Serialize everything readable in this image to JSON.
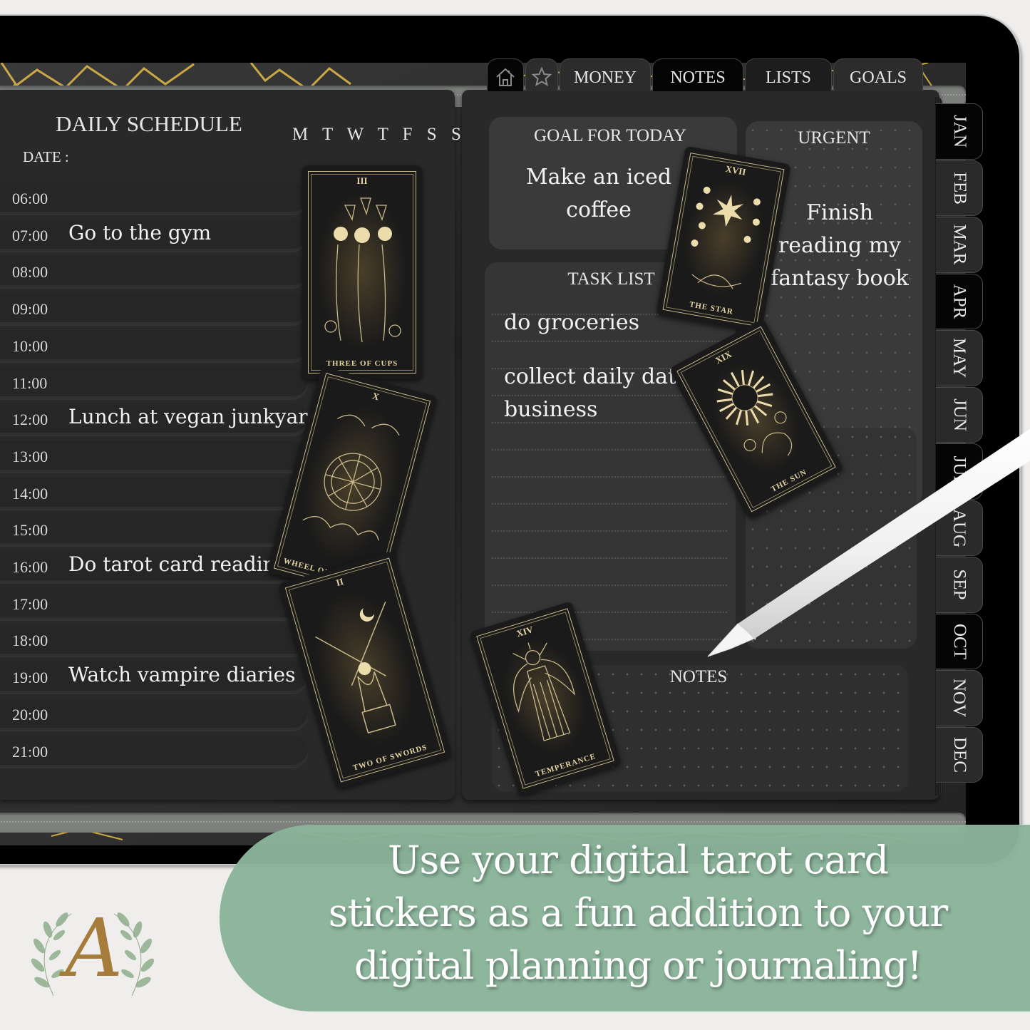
{
  "top_tabs": [
    {
      "icon": "home-icon"
    },
    {
      "icon": "star-icon"
    },
    {
      "label": "MONEY"
    },
    {
      "label": "NOTES",
      "active": true
    },
    {
      "label": "LISTS"
    },
    {
      "label": "GOALS"
    }
  ],
  "months": [
    "JAN",
    "FEB",
    "MAR",
    "APR",
    "MAY",
    "JUN",
    "JUL",
    "AUG",
    "SEP",
    "OCT",
    "NOV",
    "DEC"
  ],
  "daily_schedule": {
    "title": "DAILY SCHEDULE",
    "date_label": "DATE :",
    "weekdays": "M T W T F S S",
    "rows": [
      {
        "time": "06:00",
        "entry": ""
      },
      {
        "time": "07:00",
        "entry": "Go to the gym"
      },
      {
        "time": "08:00",
        "entry": ""
      },
      {
        "time": "09:00",
        "entry": ""
      },
      {
        "time": "10:00",
        "entry": ""
      },
      {
        "time": "11:00",
        "entry": ""
      },
      {
        "time": "12:00",
        "entry": "Lunch at vegan junkyard"
      },
      {
        "time": "13:00",
        "entry": ""
      },
      {
        "time": "14:00",
        "entry": ""
      },
      {
        "time": "15:00",
        "entry": ""
      },
      {
        "time": "16:00",
        "entry": "Do tarot card reading"
      },
      {
        "time": "17:00",
        "entry": ""
      },
      {
        "time": "18:00",
        "entry": ""
      },
      {
        "time": "19:00",
        "entry": "Watch vampire diaries"
      },
      {
        "time": "20:00",
        "entry": ""
      },
      {
        "time": "21:00",
        "entry": ""
      }
    ]
  },
  "goal_for_today": {
    "title": "GOAL FOR TODAY",
    "lines": [
      "Make an iced",
      "coffee"
    ]
  },
  "urgent": {
    "title": "URGENT",
    "lines": [
      "Finish",
      "reading my",
      "fantasy book"
    ]
  },
  "task_list": {
    "title": "TASK LIST",
    "items": [
      "do groceries",
      "collect daily data",
      "business"
    ]
  },
  "notes": {
    "title": "NOTES"
  },
  "stickers": [
    {
      "numeral": "III",
      "name": "THREE OF CUPS"
    },
    {
      "numeral": "X",
      "name": "WHEEL OF FORTUNE"
    },
    {
      "numeral": "II",
      "name": "TWO OF SWORDS"
    },
    {
      "numeral": "XVII",
      "name": "THE STAR"
    },
    {
      "numeral": "XIX",
      "name": "THE SUN"
    },
    {
      "numeral": "XIV",
      "name": "TEMPERANCE"
    }
  ],
  "banner": {
    "lines": [
      "Use your digital tarot card",
      "stickers as a fun addition to your",
      "digital planning or journaling!"
    ],
    "color": "#8ab49a"
  },
  "logo": {
    "letter": "A",
    "color": "#a67c3d"
  }
}
